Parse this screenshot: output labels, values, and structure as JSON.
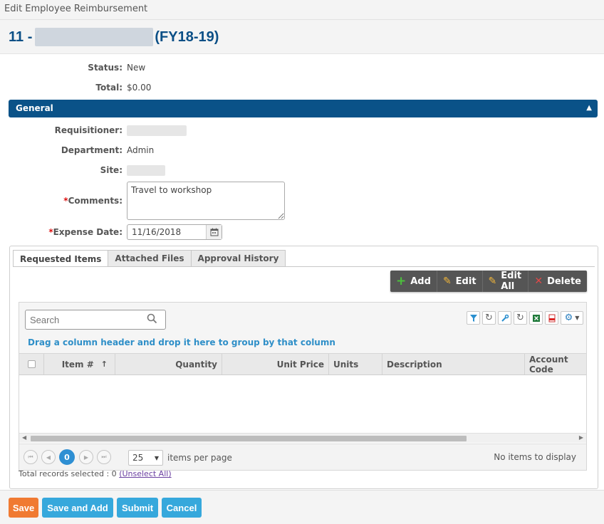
{
  "window": {
    "title": "Edit Employee Reimbursement"
  },
  "header": {
    "number": "11 -",
    "fiscal_year": "(FY18-19)"
  },
  "summary": {
    "status_label": "Status:",
    "status_value": "New",
    "total_label": "Total:",
    "total_value": "$0.00"
  },
  "general": {
    "section_title": "General",
    "collapse_icon": "caret-up-icon",
    "requisitioner_label": "Requisitioner:",
    "department_label": "Department:",
    "department_value": "Admin",
    "site_label": "Site:",
    "comments_label": "Comments:",
    "comments_value": "Travel to workshop",
    "required_mark": "*",
    "expense_date_label": "Expense Date:",
    "expense_date_value": "11/16/2018"
  },
  "tabs": [
    {
      "label": "Requested Items",
      "active": true
    },
    {
      "label": "Attached Files",
      "active": false
    },
    {
      "label": "Approval History",
      "active": false
    }
  ],
  "toolbar": {
    "add": "Add",
    "edit": "Edit",
    "edit_all": "Edit All",
    "delete": "Delete"
  },
  "grid": {
    "search_placeholder": "Search",
    "group_message": "Drag a column header and drop it here to group by that column",
    "columns": [
      "Item #",
      "Quantity",
      "Unit Price",
      "Units",
      "Description",
      "Account Code"
    ],
    "sort_indicator": "↑",
    "icons": [
      "filter-icon",
      "refresh-icon",
      "wrench-icon",
      "reset-icon",
      "excel-icon",
      "pdf-icon",
      "settings-icon"
    ]
  },
  "pager": {
    "current_page": "0",
    "page_size": "25",
    "items_per_page": "items per page",
    "no_items": "No items to display"
  },
  "selection": {
    "text": "Total records selected : 0",
    "unselect": "(Unselect All)"
  },
  "footer": {
    "save": "Save",
    "save_and_add": "Save and Add",
    "submit": "Submit",
    "cancel": "Cancel"
  },
  "colors": {
    "primary": "#0a5288",
    "accent": "#2e8fd3",
    "save": "#f07a32",
    "button": "#36a8dc",
    "required": "#d11111"
  }
}
